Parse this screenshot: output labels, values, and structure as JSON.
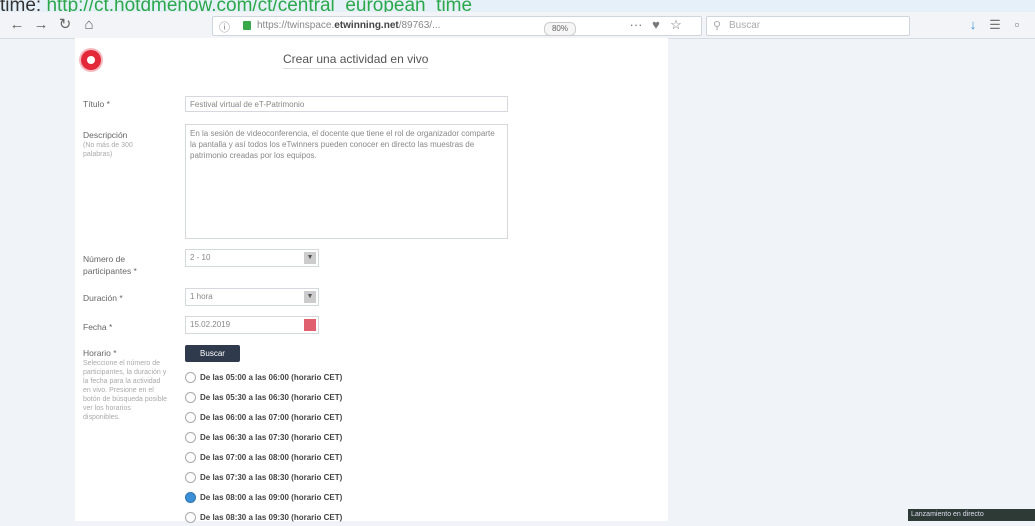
{
  "top_url": {
    "prefix": "time: ",
    "link": "http://ct.hotdmenow.com/ct/central_european_time"
  },
  "browser": {
    "url_host_pre": "https://twinspace.",
    "url_host_bold": "etwinning.net",
    "url_rest": "/89763/...",
    "zoom": "80%",
    "search_placeholder": "Buscar"
  },
  "form": {
    "page_title": "Crear una actividad en vivo",
    "title_label": "Título *",
    "title_value": "Festival virtual de eT-Patrimonio",
    "description_label": "Descripción",
    "description_hint": "(No más de 300 palabras)",
    "description_value": "En la sesión de videoconferencia, el docente que tiene el rol de organizador comparte la pantalla y así todos los eTwinners pueden conocer en directo las muestras de patrimonio creadas por los equipos.",
    "participants_label": "Número de participantes *",
    "participants_value": "2 - 10",
    "duration_label": "Duración *",
    "duration_value": "1 hora",
    "date_label": "Fecha *",
    "date_value": "15.02.2019",
    "schedule_label": "Horario *",
    "schedule_hint": "Seleccione el número de participantes, la duración y la fecha para la actividad en vivo. Presione en el botón de búsqueda posible ver los horarios disponibles.",
    "search_button": "Buscar",
    "slots": [
      {
        "label": "De las 05:00 a las 06:00 (horario CET)",
        "selected": false
      },
      {
        "label": "De las 05:30 a las 06:30 (horario CET)",
        "selected": false
      },
      {
        "label": "De las 06:00 a las 07:00 (horario CET)",
        "selected": false
      },
      {
        "label": "De las 06:30 a las 07:30 (horario CET)",
        "selected": false
      },
      {
        "label": "De las 07:00 a las 08:00 (horario CET)",
        "selected": false
      },
      {
        "label": "De las 07:30 a las 08:30 (horario CET)",
        "selected": false
      },
      {
        "label": "De las 08:00 a las 09:00 (horario CET)",
        "selected": true
      },
      {
        "label": "De las 08:30 a las 09:30 (horario CET)",
        "selected": false
      }
    ]
  },
  "status_tip": "Lanzamiento en directo"
}
